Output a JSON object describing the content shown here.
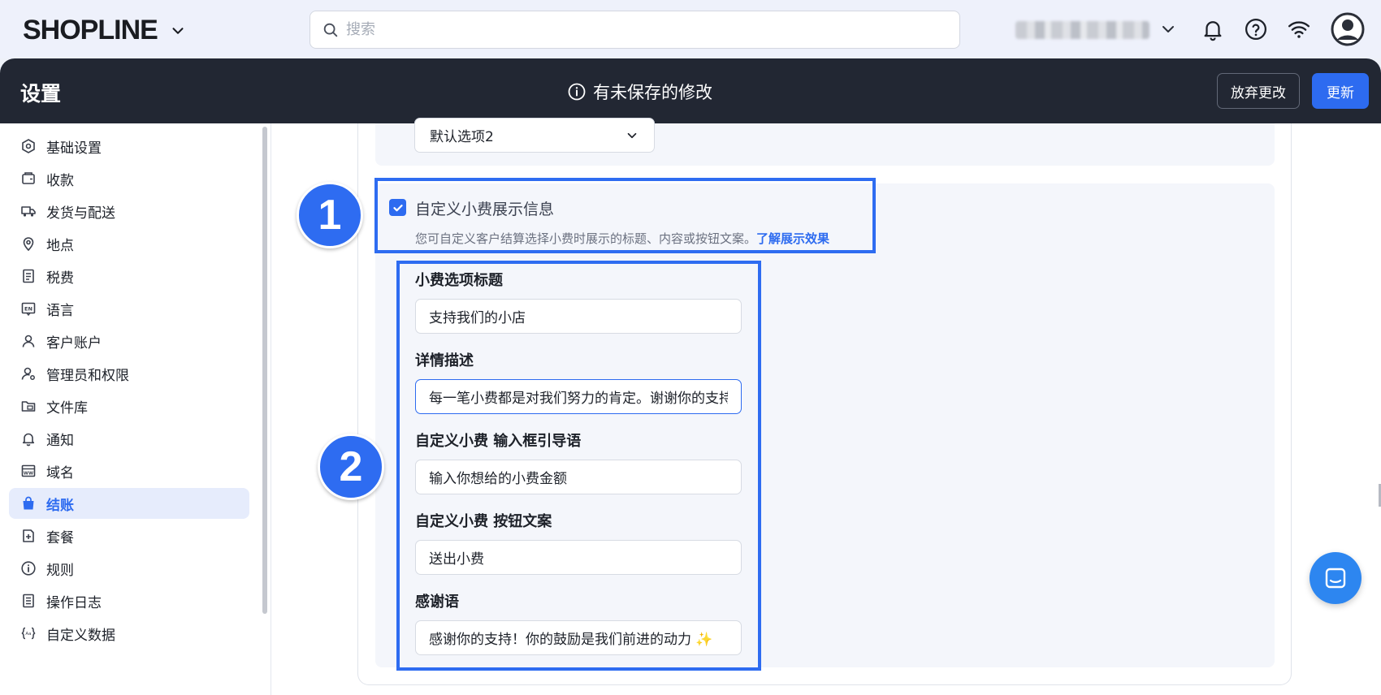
{
  "brand": {
    "logo": "SHOPLINE"
  },
  "search": {
    "placeholder": "搜索"
  },
  "header": {
    "title": "设置",
    "unsaved_notice": "有未保存的修改",
    "discard_label": "放弃更改",
    "update_label": "更新"
  },
  "sidebar": {
    "items": [
      {
        "label": "基础设置",
        "icon": "settings-hex-icon"
      },
      {
        "label": "收款",
        "icon": "wallet-icon"
      },
      {
        "label": "发货与配送",
        "icon": "truck-icon"
      },
      {
        "label": "地点",
        "icon": "location-pin-icon"
      },
      {
        "label": "税费",
        "icon": "tax-receipt-icon"
      },
      {
        "label": "语言",
        "icon": "language-icon"
      },
      {
        "label": "客户账户",
        "icon": "user-icon"
      },
      {
        "label": "管理员和权限",
        "icon": "admin-icon"
      },
      {
        "label": "文件库",
        "icon": "folder-icon"
      },
      {
        "label": "通知",
        "icon": "bell-icon"
      },
      {
        "label": "域名",
        "icon": "domain-icon"
      },
      {
        "label": "结账",
        "icon": "shopping-bag-icon",
        "active": true
      },
      {
        "label": "套餐",
        "icon": "plan-icon"
      },
      {
        "label": "规则",
        "icon": "info-icon"
      },
      {
        "label": "操作日志",
        "icon": "log-icon"
      },
      {
        "label": "自定义数据",
        "icon": "custom-data-icon"
      }
    ]
  },
  "main": {
    "default_select_value": "默认选项2",
    "custom_tip": {
      "checkbox_label": "自定义小费展示信息",
      "checked": true,
      "description": "您可自定义客户结算选择小费时展示的标题、内容或按钮文案。",
      "link_text": "了解展示效果"
    },
    "fields": [
      {
        "label": "小费选项标题",
        "value": "支持我们的小店"
      },
      {
        "label": "详情描述",
        "value": "每一笔小费都是对我们努力的肯定。谢谢你的支持！"
      },
      {
        "label": "自定义小费 输入框引导语",
        "value": "输入你想给的小费金额"
      },
      {
        "label": "自定义小费 按钮文案",
        "value": "送出小费"
      },
      {
        "label": "感谢语",
        "value": "感谢你的支持！你的鼓励是我们前进的动力 ✨"
      }
    ]
  },
  "annotations": {
    "marker_1": "1",
    "marker_2": "2"
  },
  "colors": {
    "accent": "#2d6bf0",
    "header_bg": "#222733",
    "annotation": "#2e6cf1"
  }
}
